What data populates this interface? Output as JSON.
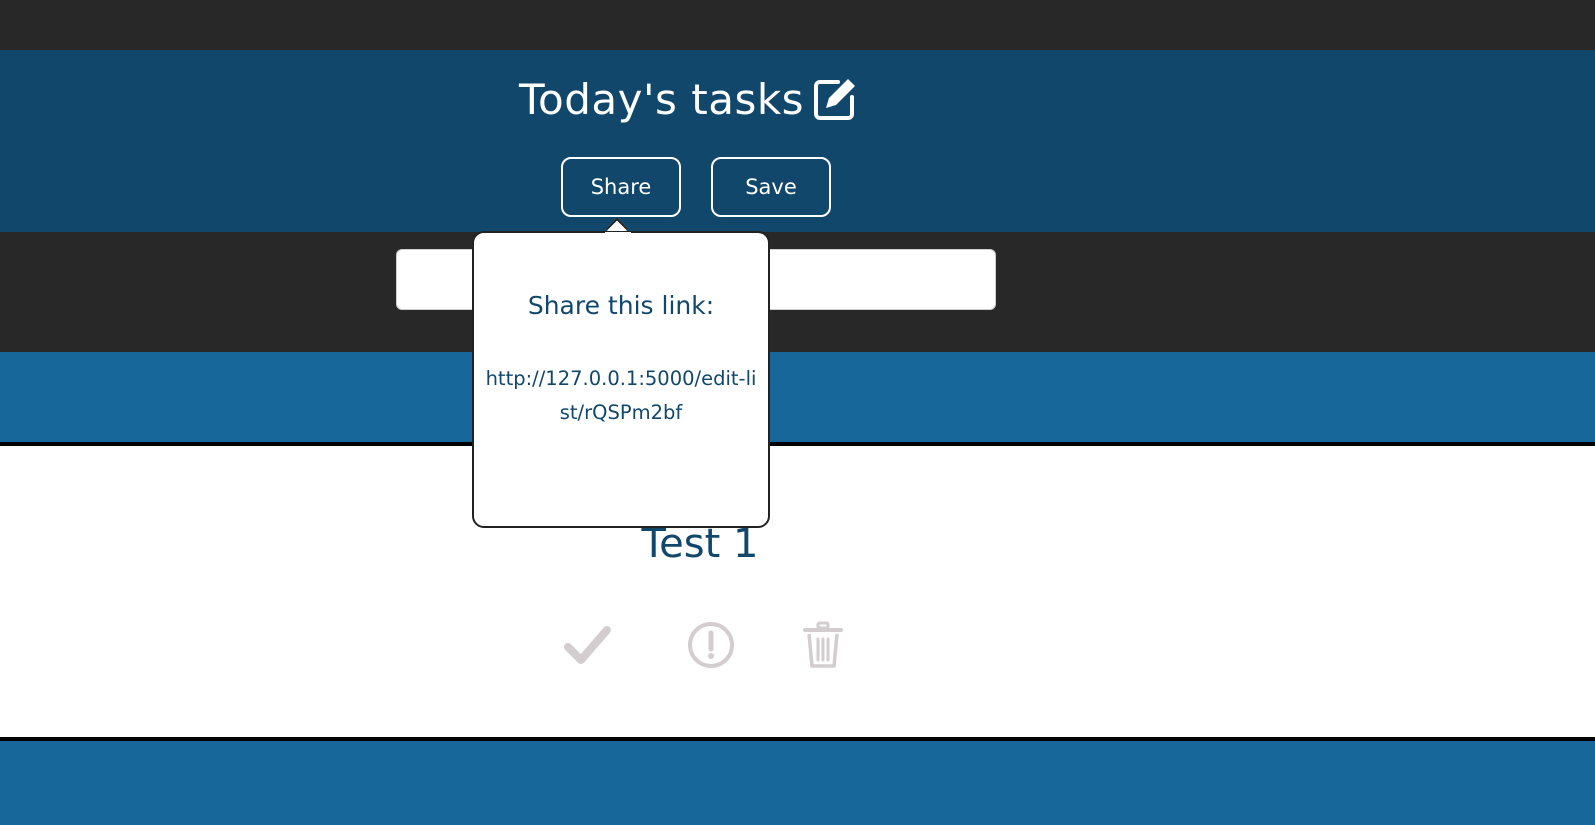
{
  "header": {
    "list_title": "Today's tasks",
    "share_label": "Share",
    "save_label": "Save"
  },
  "new_task_input": {
    "value": "",
    "placeholder": ""
  },
  "share_popover": {
    "heading": "Share this link:",
    "link": "http://127.0.0.1:5000/edit-list/rQSPm2bf"
  },
  "tasks": [
    {
      "title": "Test 1"
    }
  ],
  "icons": {
    "edit": "edit-icon",
    "done": "check-icon",
    "important": "exclamation-circle-icon",
    "delete": "trash-icon"
  },
  "colors": {
    "header_bg": "#11476b",
    "band_bg": "#17679a",
    "dark_bg": "#282828",
    "text_primary": "#11476b",
    "icon_muted": "#d3cdd0"
  }
}
